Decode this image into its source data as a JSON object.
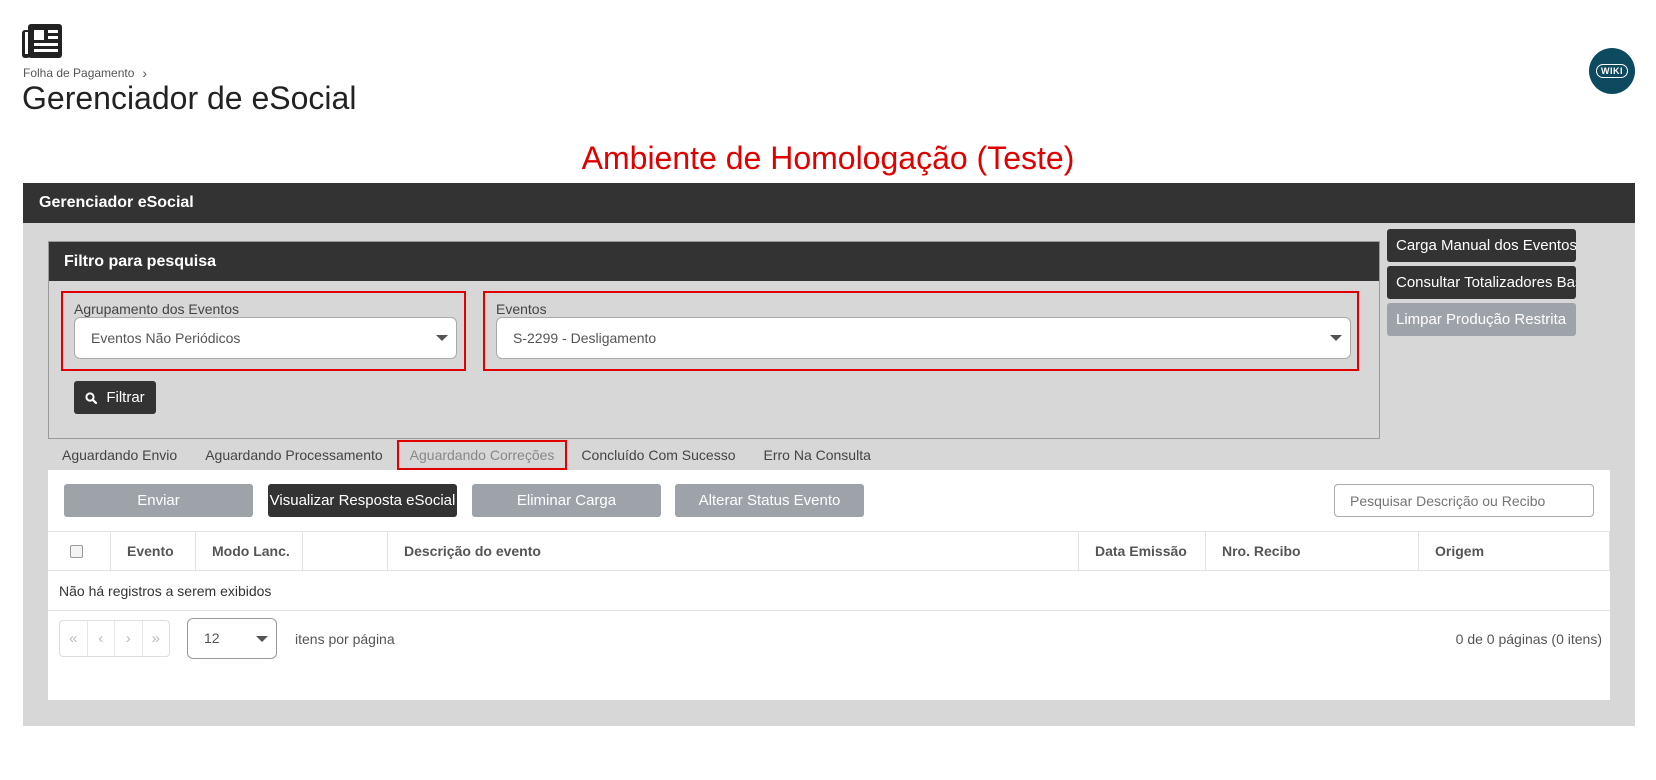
{
  "header": {
    "breadcrumb": "Folha de Pagamento",
    "title": "Gerenciador de eSocial",
    "wiki_label": "WIKI"
  },
  "environment_banner": "Ambiente de Homologação (Teste)",
  "panel": {
    "title": "Gerenciador eSocial",
    "filter": {
      "title": "Filtro para pesquisa",
      "group_label": "Agrupamento dos Eventos",
      "group_value": "Eventos Não Periódicos",
      "events_label": "Eventos",
      "events_value": "S-2299 - Desligamento",
      "filter_button": "Filtrar"
    },
    "side_buttons": {
      "manual_load": "Carga Manual dos Eventos",
      "totals": "Consultar Totalizadores Base",
      "clear": "Limpar Produção Restrita"
    },
    "tabs": [
      "Aguardando Envio",
      "Aguardando Processamento",
      "Aguardando Correções",
      "Concluído Com Sucesso",
      "Erro Na Consulta"
    ],
    "actions": {
      "send": "Enviar",
      "view_response": "Visualizar Resposta eSocial",
      "delete_load": "Eliminar Carga",
      "change_status": "Alterar Status Evento",
      "search_placeholder": "Pesquisar Descrição ou Recibo"
    },
    "table": {
      "columns": [
        "Evento",
        "Modo Lanc.",
        "",
        "Descrição do evento",
        "Data Emissão",
        "Nro. Recibo",
        "Origem"
      ],
      "empty_message": "Não há registros a serem exibidos"
    },
    "pager": {
      "page_size": "12",
      "items_label": "itens por página",
      "page_info": "0 de 0 páginas (0 itens)"
    }
  }
}
